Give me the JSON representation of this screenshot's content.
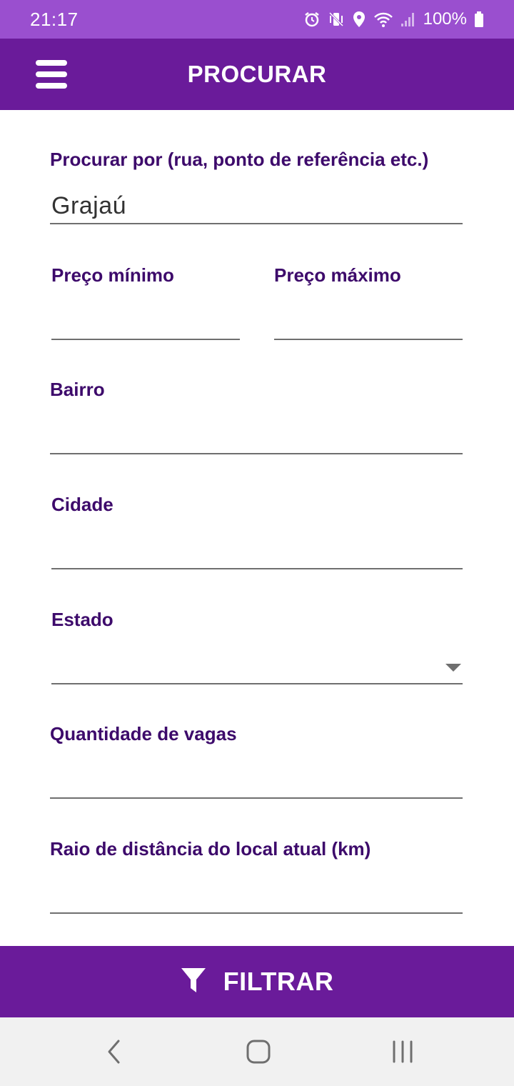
{
  "status_bar": {
    "time": "21:17",
    "battery": "100%",
    "icons": [
      "alarm-icon",
      "vibrate-icon",
      "location-icon",
      "wifi-icon",
      "signal-icon",
      "battery-icon"
    ]
  },
  "app_bar": {
    "title": "PROCURAR",
    "menu_icon": "hamburger-menu-icon"
  },
  "form": {
    "search": {
      "label": "Procurar por (rua, ponto de referência etc.)",
      "value": "Grajaú"
    },
    "min_price": {
      "label": "Preço mínimo",
      "value": ""
    },
    "max_price": {
      "label": "Preço máximo",
      "value": ""
    },
    "neighborhood": {
      "label": "Bairro",
      "value": ""
    },
    "city": {
      "label": "Cidade",
      "value": ""
    },
    "state": {
      "label": "Estado",
      "value": ""
    },
    "spots": {
      "label": "Quantidade de vagas",
      "value": ""
    },
    "radius": {
      "label": "Raio de distância do local atual (km)",
      "value": ""
    }
  },
  "filter_button": {
    "label": "FILTRAR",
    "icon": "filter-funnel-icon"
  },
  "nav_bar": {
    "buttons": [
      "back-icon",
      "home-icon",
      "recent-apps-icon"
    ]
  },
  "colors": {
    "status_bar": "#9a4fcf",
    "primary": "#6a1b9a",
    "label": "#3d0a6b",
    "nav_bar": "#f1f1f1"
  }
}
